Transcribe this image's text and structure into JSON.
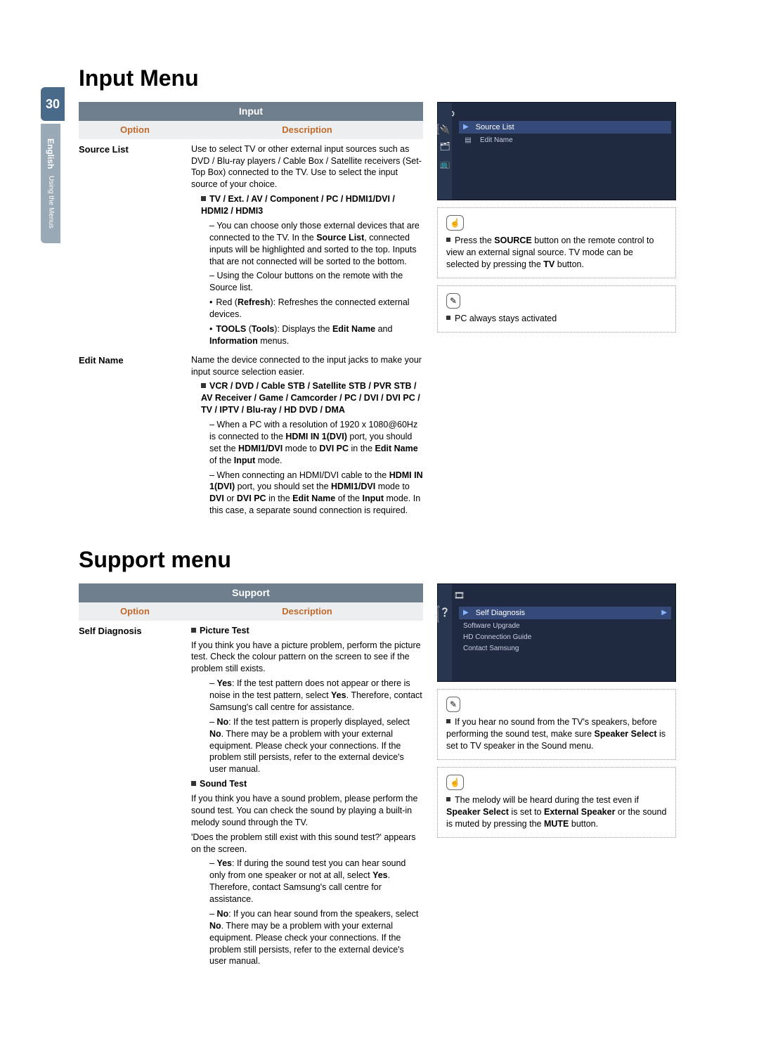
{
  "page_number": "30",
  "side": {
    "language": "English",
    "section": "Using the Menus"
  },
  "input": {
    "title": "Input Menu",
    "table_title": "Input",
    "headers": {
      "option": "Option",
      "description": "Description"
    },
    "source_list": {
      "label": "Source List",
      "intro": "Use to select TV or other external input sources such as DVD / Blu-ray players / Cable Box / Satellite receivers (Set-Top Box) connected to the TV. Use to select the input source of your choice.",
      "bullet_label": "TV / Ext. / AV / Component / PC / HDMI1/DVI / HDMI2 / HDMI3",
      "dash1": "You can choose only those external devices that are connected to the TV. In the Source List, connected inputs will be highlighted and sorted to the top. Inputs that are not connected will be sorted to the bottom.",
      "dash2": "Using the Colour buttons on the remote with the Source list.",
      "dot1": "Red (Refresh): Refreshes the connected external devices.",
      "dot2": "TOOLS (Tools): Displays the Edit Name and Information menus."
    },
    "edit_name": {
      "label": "Edit Name",
      "intro": "Name the device connected to the input jacks to make your input source selection easier.",
      "bullet_label": "VCR / DVD / Cable STB / Satellite STB / PVR STB / AV Receiver / Game / Camcorder / PC / DVI / DVI PC / TV / IPTV / Blu-ray / HD DVD / DMA",
      "dash1": "When a PC with a resolution of 1920 x 1080@60Hz is connected to the HDMI IN 1(DVI) port, you should set the HDMI1/DVI mode to DVI PC in the Edit Name of the Input mode.",
      "dash2": "When connecting an HDMI/DVI cable to the HDMI IN 1(DVI) port, you should set the HDMI1/DVI mode to DVI or DVI PC in the Edit Name of the Input mode. In this case, a separate sound connection is required."
    },
    "osd": {
      "side_label": "Input",
      "selected": "Source List",
      "items": [
        "Edit Name"
      ]
    },
    "note1": "Press the SOURCE button on the remote control to view an external signal source. TV mode can be selected by pressing the TV button.",
    "note2": "PC always stays activated"
  },
  "support": {
    "title": "Support menu",
    "table_title": "Support",
    "headers": {
      "option": "Option",
      "description": "Description"
    },
    "self_diag": {
      "label": "Self Diagnosis",
      "pict_title": "Picture Test",
      "pict_intro": "If you think you have a picture problem, perform the picture test. Check the colour pattern on the screen to see if the problem still exists.",
      "pict_yes": "Yes: If the test pattern does not appear or there is noise in the test pattern, select Yes. Therefore, contact Samsung's call centre for assistance.",
      "pict_no": "No: If the test pattern is properly displayed, select No. There may be a problem with your external equipment. Please check your connections. If the problem still persists, refer to the external device's user manual.",
      "snd_title": "Sound Test",
      "snd_intro": "If you think you have a sound problem, please perform the sound test. You can check the sound by playing a built-in melody sound through the TV.",
      "snd_prompt": "'Does the problem still exist with this sound test?' appears on the screen.",
      "snd_yes": "Yes: If during the sound test you can hear sound only from one speaker or not at all, select Yes. Therefore, contact Samsung's call centre for assistance.",
      "snd_no": "No: If you can hear sound from the speakers, select No. There may be a problem with your external equipment. Please check your connections. If the problem still persists, refer to the external device's user manual."
    },
    "osd": {
      "side_label": "Support",
      "selected": "Self Diagnosis",
      "items": [
        "Software Upgrade",
        "HD Connection Guide",
        "Contact Samsung"
      ]
    },
    "note1": "If you hear no sound from the TV's speakers, before performing the sound test, make sure Speaker Select is set to TV speaker in the Sound menu.",
    "note2": "The melody will be heard during the test even if Speaker Select is set to External Speaker or the sound is muted by pressing the MUTE button."
  }
}
